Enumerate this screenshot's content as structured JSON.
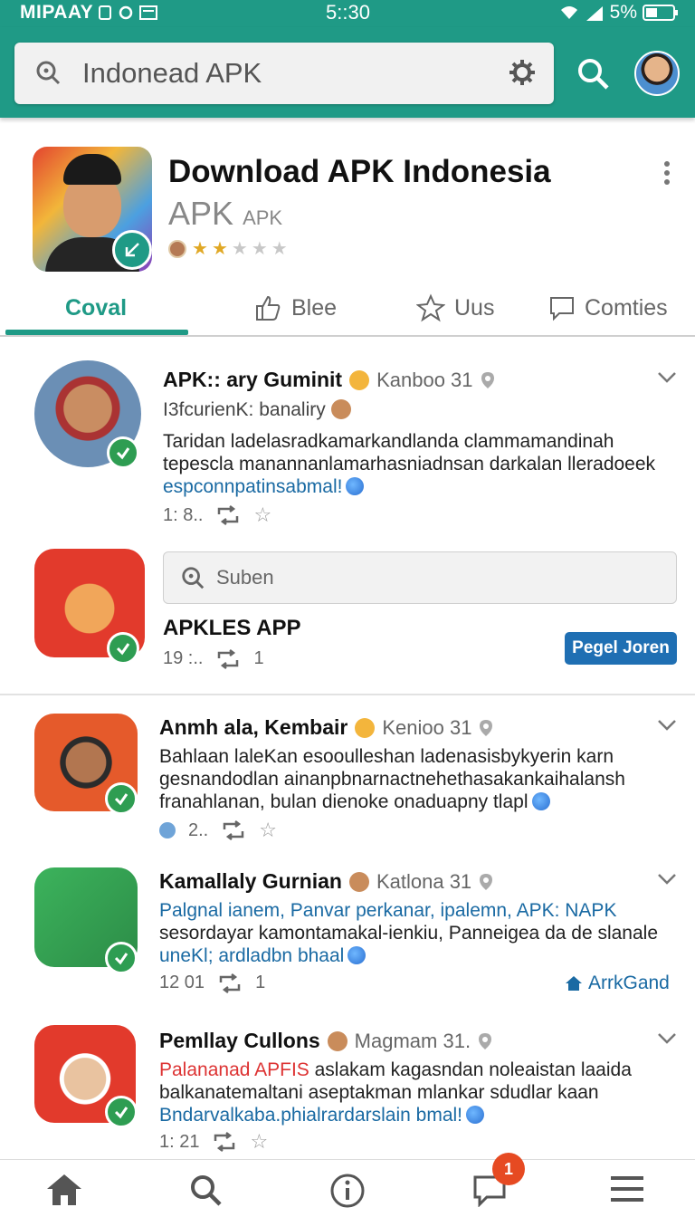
{
  "status_bar": {
    "carrier": "MIPAAY",
    "time": "5::30",
    "battery": "5%"
  },
  "app_bar": {
    "search_value": "Indonead APK"
  },
  "app_header": {
    "title": "Download APK Indonesia",
    "subtitle": "APK",
    "subtitle_small": "APK",
    "rating_stars": 2,
    "rating_max": 5
  },
  "tabs": [
    {
      "label": "Coval",
      "active": true
    },
    {
      "label": "Blee",
      "active": false
    },
    {
      "label": "Uus",
      "active": false
    },
    {
      "label": "Comties",
      "active": false
    }
  ],
  "posts": [
    {
      "author": "APK:: ary Guminit",
      "meta": "Kanboo 31",
      "subline": "I3fcurienK: banaliry",
      "lines": [
        "Taridan ladelasradkamarkandlanda clammamandinah",
        "tepescla manannanlamarhasniadnsan darkalan lleradoeek"
      ],
      "link": "espconnpatinsabmal!",
      "count": "1: 8..",
      "avatar_color": "#7a5a3c"
    },
    {
      "inner_search_placeholder": "Suben",
      "title": "APKLES APP",
      "count": "19 :..",
      "reshare_count": "1",
      "button_label": "Pegel Joren"
    },
    {
      "author": "Anmh ala, Kembair",
      "meta": "Kenioo 31",
      "lines": [
        "Bahlaan laleKan esooulleshan ladenasisbykyerin karn",
        "gesnandodlan ainanpbnarnactnehethasakankaihalansh",
        "franahlanan, bulan dienoke onaduapny tlapl"
      ],
      "count": "2.."
    },
    {
      "author": "Kamallaly Gurnian",
      "meta": "Katlona 31",
      "lines": [
        "Palgnal ianem, Panvar perkanar, ipalemn, APK: NAPK",
        "sesordayar kamontamakal-ienkiu, Panneigea da de slanale",
        "uneKl; ardladbn bhaal"
      ],
      "count": "12 01",
      "reshare_count": "1",
      "action_label": "ArrkGand"
    },
    {
      "author": "Pemllay Cullons",
      "meta": "Magmam 31.",
      "highlight": "Palananad APFIS",
      "lines": [
        " aslakam kagasndan noleaistan laaida",
        "balkanatemaltani  aseptakman mlankar sdudlar kaan",
        "Bndarvalkaba.phialrardarslain bmal!"
      ],
      "count": "1: 21"
    }
  ],
  "bottom_nav": {
    "notifications_badge": "1"
  },
  "colors": {
    "brand": "#1f9a86",
    "link": "#1a6aa3",
    "verify": "#2e9d52",
    "badge": "#e64a22"
  }
}
